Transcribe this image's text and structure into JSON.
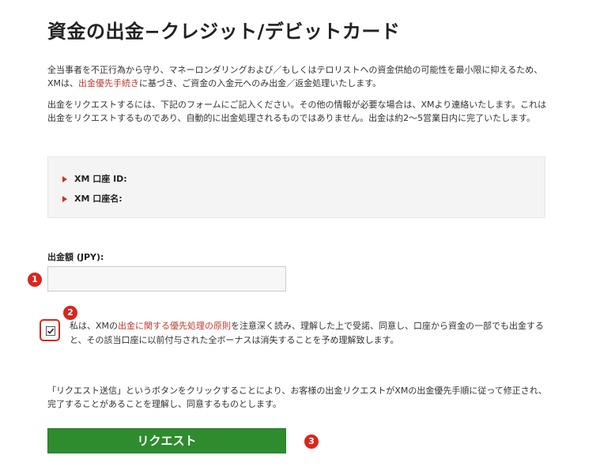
{
  "page": {
    "title": "資金の出金−クレジット/デビットカード"
  },
  "intro": {
    "p1_before": "全当事者を不正行為から守り、マネーロンダリングおよび／もしくはテロリストへの資金供給の可能性を最小限に抑えるため、XMは、",
    "p1_link": "出金優先手続き",
    "p1_after": "に基づき、ご資金の入金元へのみ出金／返金処理いたします。",
    "p2": "出金をリクエストするには、下記のフォームにご記入ください。その他の情報が必要な場合は、XMより連絡いたします。これは出金をリクエストするものであり、自動的に出金処理されるものではありません。出金は約2〜5営業日内に完了いたします。"
  },
  "account_info": {
    "id_label": "XM 口座 ID:",
    "name_label": "XM 口座名:"
  },
  "amount": {
    "label": "出金額 (JPY):",
    "value": "",
    "placeholder": ""
  },
  "markers": {
    "one": "1",
    "two": "2",
    "three": "3"
  },
  "agreement": {
    "checked": true,
    "before": "私は、XMの",
    "link": "出金に関する優先処理の原則",
    "after": "を注意深く読み、理解した上で受諾、同意し、口座から資金の一部でも出金すると、その該当口座に以前付与された全ボーナスは消失することを予め理解致します。"
  },
  "notice": {
    "text": "「リクエスト送信」というボタンをクリックすることにより、お客様の出金リクエストがXMの出金優先手順に従って修正され、完了することがあることを理解し、同意するものとします。"
  },
  "submit": {
    "label": "リクエスト"
  },
  "colors": {
    "accent_red": "#d9261c",
    "link_red": "#c0392b",
    "button_green": "#2e8b2e"
  }
}
